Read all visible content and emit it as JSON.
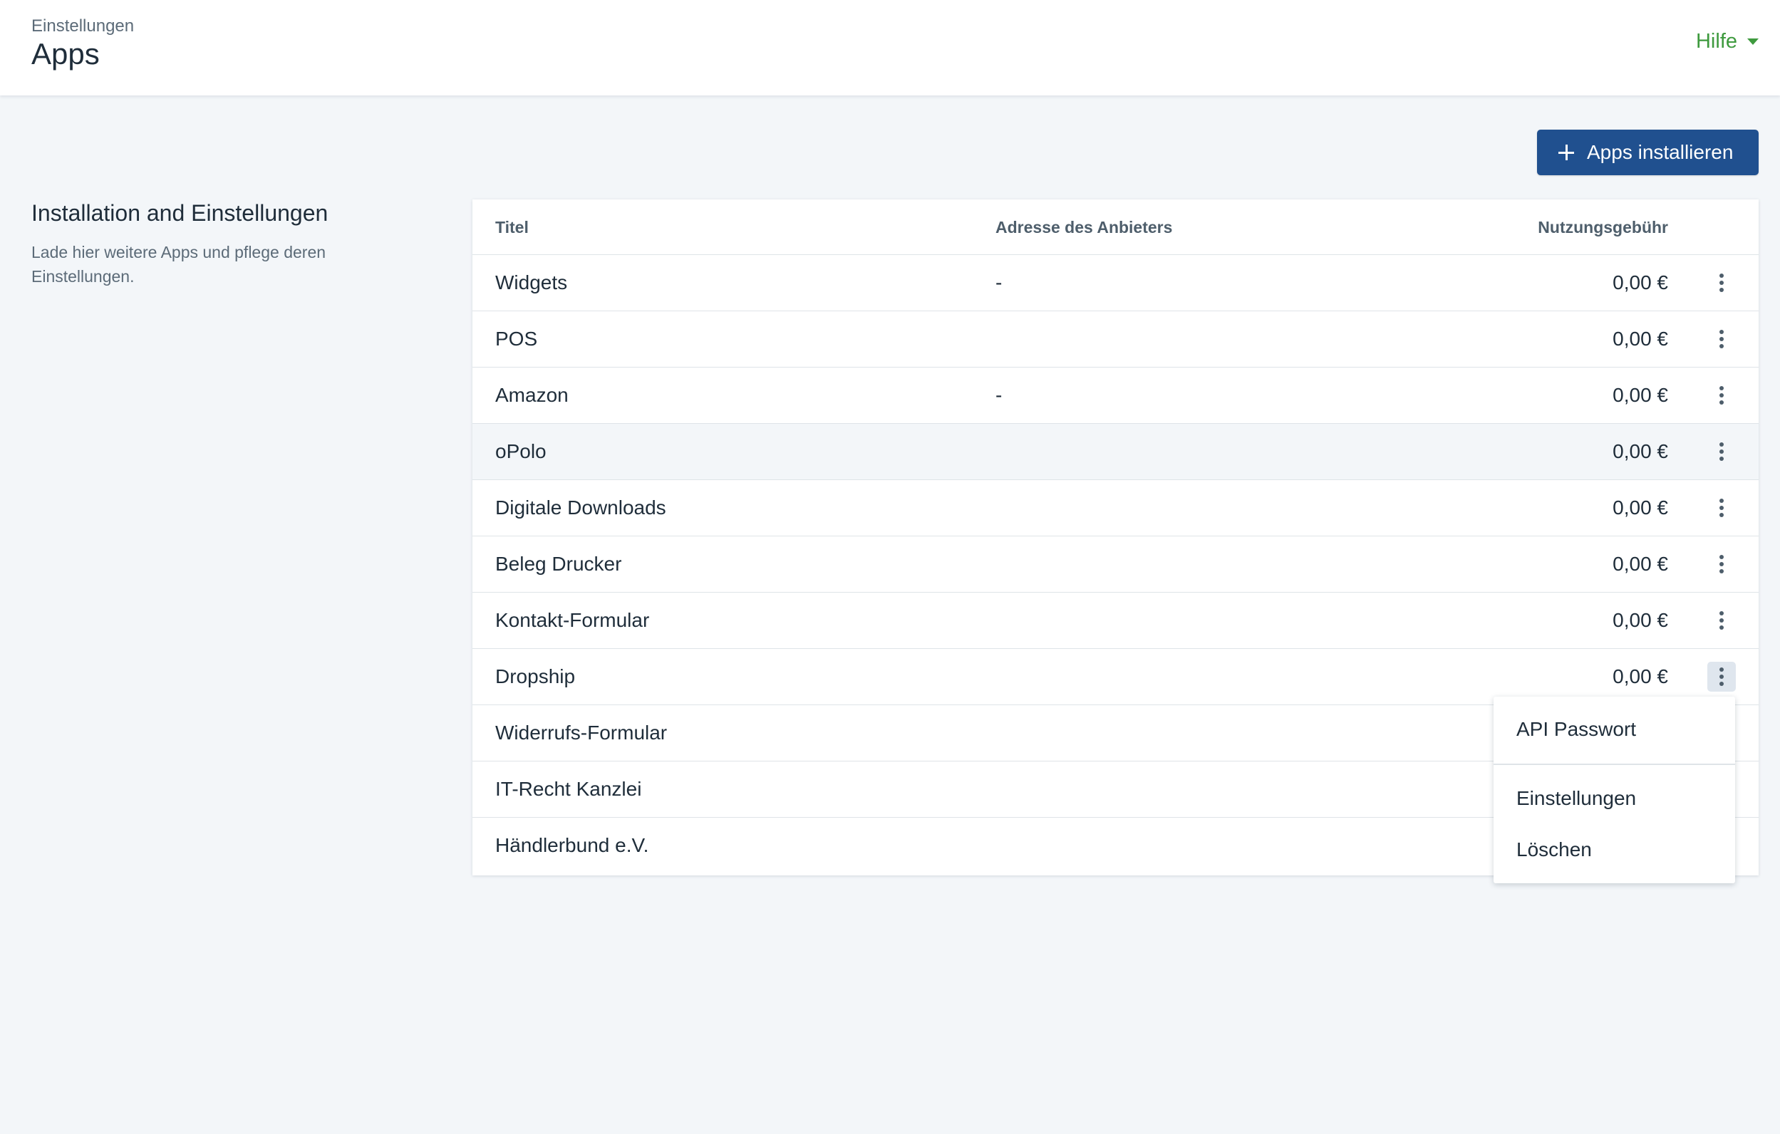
{
  "header": {
    "breadcrumb": "Einstellungen",
    "title": "Apps",
    "help_label": "Hilfe"
  },
  "actions": {
    "install_label": "Apps installieren"
  },
  "section": {
    "title": "Installation and Einstellungen",
    "description": "Lade hier weitere Apps und pflege deren Einstellungen."
  },
  "table": {
    "columns": {
      "title": "Titel",
      "address": "Adresse des Anbieters",
      "fee": "Nutzungsgebühr"
    },
    "rows": [
      {
        "title": "Widgets",
        "address": "-",
        "fee": "0,00 €"
      },
      {
        "title": "POS",
        "address": "",
        "fee": "0,00 €"
      },
      {
        "title": "Amazon",
        "address": "-",
        "fee": "0,00 €"
      },
      {
        "title": "oPolo",
        "address": "",
        "fee": "0,00 €"
      },
      {
        "title": "Digitale Downloads",
        "address": "",
        "fee": "0,00 €"
      },
      {
        "title": "Beleg Drucker",
        "address": "",
        "fee": "0,00 €"
      },
      {
        "title": "Kontakt-Formular",
        "address": "",
        "fee": "0,00 €"
      },
      {
        "title": "Dropship",
        "address": "",
        "fee": "0,00 €"
      },
      {
        "title": "Widerrufs-Formular",
        "address": "",
        "fee": ""
      },
      {
        "title": "IT-Recht Kanzlei",
        "address": "",
        "fee": ""
      },
      {
        "title": "Händlerbund e.V.",
        "address": "",
        "fee": ""
      }
    ]
  },
  "context_menu": {
    "items": [
      "API Passwort",
      "Einstellungen",
      "Löschen"
    ]
  },
  "icons": {
    "row_menu": "more-vertical-icon",
    "install": "plus-icon",
    "help_dropdown": "caret-down-icon"
  },
  "colors": {
    "primary": "#20508f",
    "help": "#3e9a3e",
    "background": "#f3f6f9"
  }
}
